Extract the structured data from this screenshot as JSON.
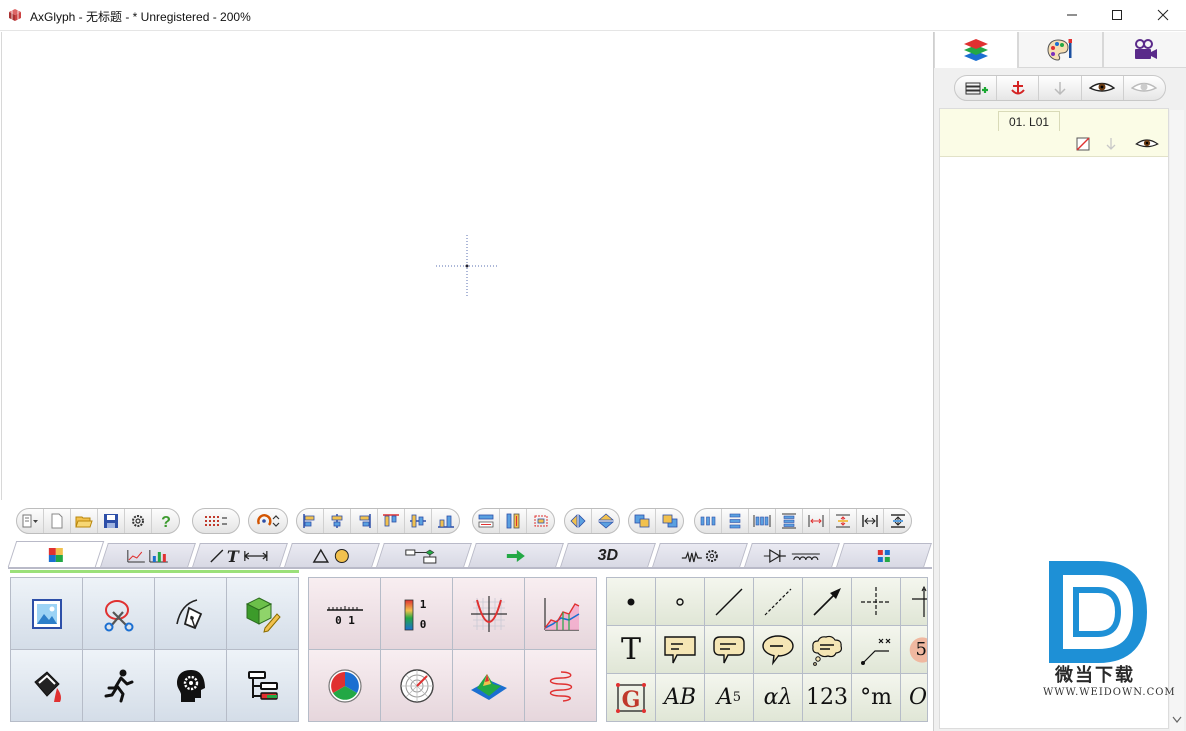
{
  "window": {
    "title": "AxGlyph - 无标题 - * Unregistered - 200%",
    "controls": [
      "minimize-icon",
      "maximize-icon",
      "close-icon"
    ]
  },
  "right_panel": {
    "tabs": [
      "layers-icon",
      "palette-icon",
      "camera-icon"
    ],
    "toolbar": [
      "add-layer-icon",
      "anchor-icon",
      "arrow-down-icon",
      "eye-icon",
      "eye-hidden-icon"
    ],
    "layers": [
      {
        "label": "01. L01"
      }
    ]
  },
  "toolbar": {
    "groups": [
      [
        "menu-icon",
        "new-file-icon",
        "open-folder-icon",
        "save-icon",
        "settings-icon",
        "help-icon"
      ],
      [
        "grid-icon"
      ],
      [
        "rotate-icon"
      ],
      [
        "align-left-icon",
        "align-center-icon",
        "align-right-icon",
        "align-top-icon",
        "align-middle-icon",
        "align-bottom-icon"
      ],
      [
        "distribute-h-icon",
        "distribute-v-icon",
        "distribute-center-icon"
      ],
      [
        "flip-h-icon",
        "flip-v-icon"
      ],
      [
        "bring-front-icon",
        "send-back-icon"
      ],
      [
        "space-h-icon",
        "space-v-icon",
        "space-h2-icon",
        "space-v2-icon",
        "stretch-h-icon",
        "stretch-v-icon",
        "stretch-h2-icon",
        "stretch-v2-icon"
      ]
    ]
  },
  "category_tabs": [
    {
      "icon": "image-tiles-icon"
    },
    {
      "icon": "chart-icon"
    },
    {
      "icon": "line-text-icon"
    },
    {
      "icon": "shapes-icon"
    },
    {
      "icon": "flowchart-icon"
    },
    {
      "icon": "arrow-right-icon"
    },
    {
      "label": "3D"
    },
    {
      "icon": "resistor-gear-icon"
    },
    {
      "icon": "diode-inductor-icon"
    },
    {
      "icon": "color-grid-icon"
    }
  ],
  "panel_general": [
    "picture-icon",
    "scissors-icon",
    "pen-nib-icon",
    "cube-pencil-icon",
    "bucket-icon",
    "runner-icon",
    "brain-gear-icon",
    "tree-list-icon"
  ],
  "panel_math": {
    "axis_label": "0 1",
    "colorbar_labels": [
      "1",
      "0"
    ],
    "icons": [
      "number-axis-icon",
      "color-bar-icon",
      "function-plot-icon",
      "area-chart-icon",
      "pie-chart-icon",
      "polar-icon",
      "surface-icon",
      "spiral-icon"
    ]
  },
  "panel_symbols": {
    "text_cells": [
      "T",
      "AB",
      "A",
      "5",
      "αλ",
      "123",
      "°m",
      "O",
      "5"
    ],
    "icons": [
      "dot-icon",
      "circle-icon",
      "line-icon",
      "dashed-line-icon",
      "arrow-icon",
      "crosshair-icon",
      "axis-icon",
      "callout-rect-icon",
      "callout-round-icon",
      "callout-oval-icon",
      "thought-bubble-icon",
      "dimension-line-icon",
      "number-badge-icon",
      "glyph-g-icon"
    ]
  },
  "watermark": {
    "text": "微当下载",
    "url": "WWW.WEIDOWN.COM"
  },
  "colors": {
    "accent_blue": "#1e90d6",
    "panel_blue": "#d4dde8",
    "panel_pink": "#e6d6dc",
    "panel_green": "#e0e6d6",
    "layer_bg": "#fbfce6"
  }
}
